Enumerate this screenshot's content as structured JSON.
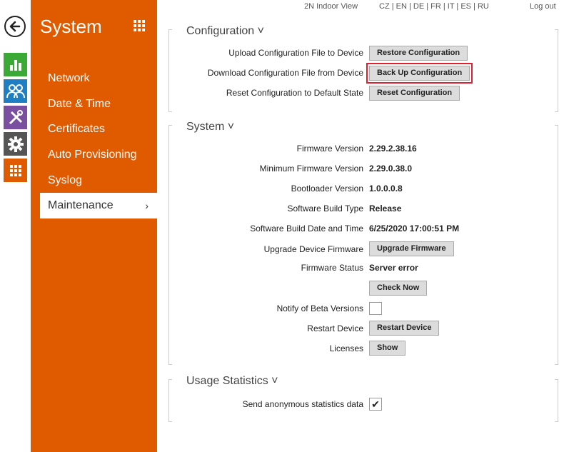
{
  "topbar": {
    "indoor_view": "2N Indoor View",
    "languages": "CZ | EN | DE | FR | IT | ES | RU",
    "logout": "Log out"
  },
  "sidebar": {
    "title": "System",
    "items": [
      {
        "label": "Network"
      },
      {
        "label": "Date & Time"
      },
      {
        "label": "Certificates"
      },
      {
        "label": "Auto Provisioning"
      },
      {
        "label": "Syslog"
      },
      {
        "label": "Maintenance",
        "active": true,
        "chevron": "›"
      }
    ]
  },
  "rail": {
    "icons": [
      "back-arrow-icon",
      "status-chart-icon",
      "directory-users-icon",
      "hardware-tools-icon",
      "system-gear-icon",
      "services-grid-icon"
    ],
    "colors": {
      "green": "#3aa935",
      "blue": "#1f7fc4",
      "purple": "#7b4fa0",
      "gray": "#555555",
      "orange": "#e05a00"
    }
  },
  "configuration": {
    "title": "Configuration ˅",
    "rows": [
      {
        "label": "Upload Configuration File to Device",
        "button": "Restore Configuration"
      },
      {
        "label": "Download Configuration File from Device",
        "button": "Back Up Configuration"
      },
      {
        "label": "Reset Configuration to Default State",
        "button": "Reset Configuration"
      }
    ]
  },
  "system": {
    "title": "System ˅",
    "firmware_version_label": "Firmware Version",
    "firmware_version": "2.29.2.38.16",
    "min_firmware_label": "Minimum Firmware Version",
    "min_firmware": "2.29.0.38.0",
    "bootloader_label": "Bootloader Version",
    "bootloader": "1.0.0.0.8",
    "build_type_label": "Software Build Type",
    "build_type": "Release",
    "build_date_label": "Software Build Date and Time",
    "build_date": "6/25/2020 17:00:51 PM",
    "upgrade_label": "Upgrade Device Firmware",
    "upgrade_button": "Upgrade Firmware",
    "status_label": "Firmware Status",
    "status": "Server error",
    "check_now_button": "Check Now",
    "beta_label": "Notify of Beta Versions",
    "beta_checked": false,
    "restart_label": "Restart Device",
    "restart_button": "Restart Device",
    "licenses_label": "Licenses",
    "licenses_button": "Show"
  },
  "usage": {
    "title": "Usage Statistics ˅",
    "send_label": "Send anonymous statistics data",
    "send_checked": true,
    "checkmark": "✔"
  }
}
